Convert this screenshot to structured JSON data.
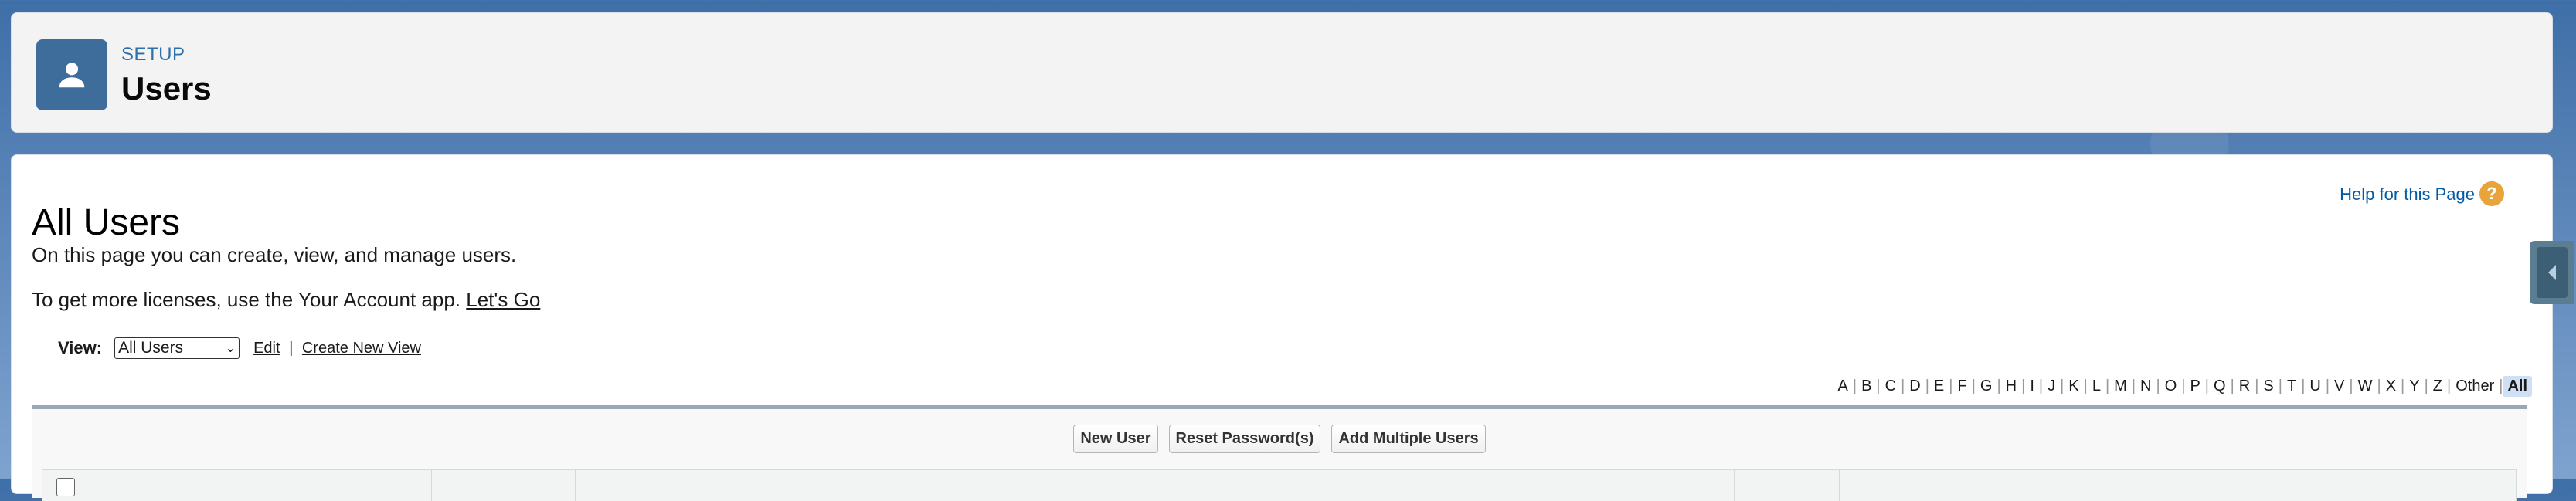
{
  "header": {
    "eyebrow": "SETUP",
    "title": "Users",
    "icon": "user-icon"
  },
  "main": {
    "title": "All Users",
    "help_link": "Help for this Page",
    "help_icon": "?",
    "description": "On this page you can create, view, and manage users.",
    "licenses_text": "To get more licenses, use the Your Account app.",
    "licenses_link": "Let's Go",
    "view": {
      "label": "View:",
      "selected": "All Users",
      "edit_link": "Edit",
      "separator": "|",
      "create_link": "Create New View"
    },
    "alphabet": [
      "A",
      "B",
      "C",
      "D",
      "E",
      "F",
      "G",
      "H",
      "I",
      "J",
      "K",
      "L",
      "M",
      "N",
      "O",
      "P",
      "Q",
      "R",
      "S",
      "T",
      "U",
      "V",
      "W",
      "X",
      "Y",
      "Z",
      "Other",
      "All"
    ],
    "active_letter": "All",
    "buttons": {
      "new_user": "New User",
      "reset_password": "Reset Password(s)",
      "add_multiple": "Add Multiple Users"
    }
  },
  "colors": {
    "accent": "#3e6d9b",
    "link": "#015ba7",
    "help": "#e8a33b"
  }
}
